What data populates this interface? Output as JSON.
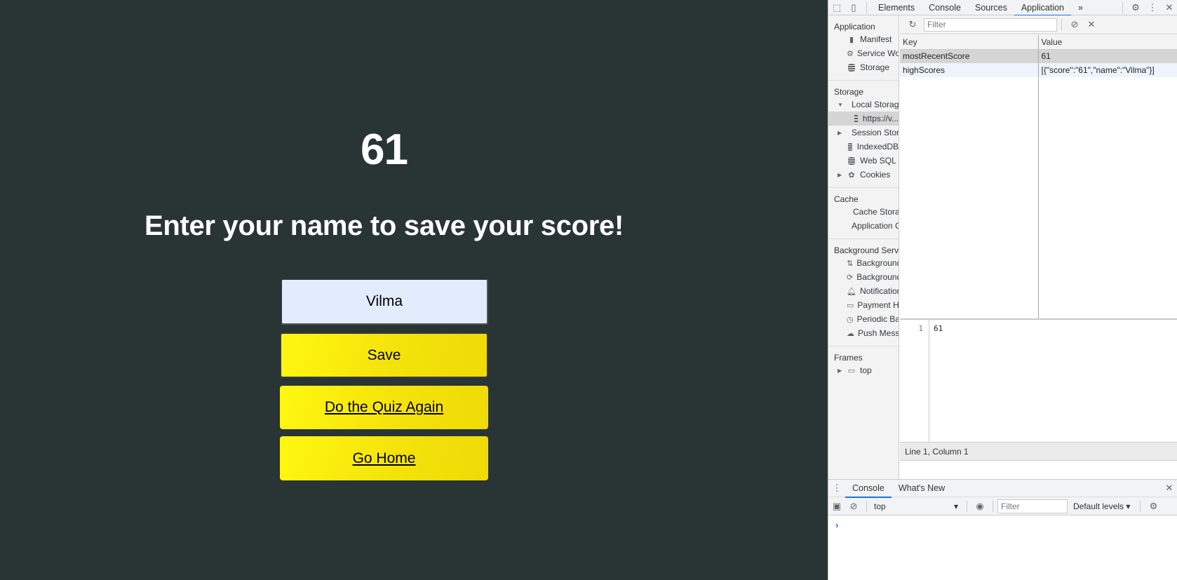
{
  "page": {
    "score": "61",
    "prompt": "Enter your name to save your score!",
    "name_input": {
      "value": "Vilma",
      "placeholder": ""
    },
    "buttons": {
      "save": "Save",
      "quiz_again": "Do the Quiz Again",
      "go_home": "Go Home"
    },
    "colors": {
      "background": "#293435",
      "button_yellow": "#f4e30b",
      "input_bg": "#e3ecfd"
    }
  },
  "devtools": {
    "tabs": [
      "Elements",
      "Console",
      "Sources",
      "Application"
    ],
    "active_tab": "Application",
    "more_tabs": "»",
    "sidebar": {
      "sections": [
        {
          "title": "Application",
          "items": [
            {
              "label": "Manifest",
              "icon": "file-icon"
            },
            {
              "label": "Service Workers",
              "icon": "gear-icon"
            },
            {
              "label": "Storage",
              "icon": "database-icon"
            }
          ]
        },
        {
          "title": "Storage",
          "items": [
            {
              "label": "Local Storage",
              "icon": "grid-icon",
              "expanded": true
            },
            {
              "label": "https://v...",
              "icon": "grid-icon",
              "selected": true
            },
            {
              "label": "Session Storage",
              "icon": "grid-icon",
              "expandable": true
            },
            {
              "label": "IndexedDB",
              "icon": "database-icon"
            },
            {
              "label": "Web SQL",
              "icon": "database-icon"
            },
            {
              "label": "Cookies",
              "icon": "cookie-icon",
              "expandable": true
            }
          ]
        },
        {
          "title": "Cache",
          "items": [
            {
              "label": "Cache Storage",
              "icon": "database-icon"
            },
            {
              "label": "Application Cache",
              "icon": "grid-icon"
            }
          ]
        },
        {
          "title": "Background Services",
          "items": [
            {
              "label": "Background Fetch",
              "icon": "arrows-updown-icon"
            },
            {
              "label": "Background Sync",
              "icon": "sync-icon"
            },
            {
              "label": "Notifications",
              "icon": "bell-icon"
            },
            {
              "label": "Payment Handler",
              "icon": "card-icon"
            },
            {
              "label": "Periodic Background Sync",
              "icon": "clock-icon"
            },
            {
              "label": "Push Messaging",
              "icon": "cloud-icon"
            }
          ]
        },
        {
          "title": "Frames",
          "items": [
            {
              "label": "top",
              "icon": "frame-icon",
              "expandable": true
            }
          ]
        }
      ]
    },
    "storage": {
      "filter_placeholder": "Filter",
      "columns": [
        "Key",
        "Value"
      ],
      "rows": [
        {
          "key": "mostRecentScore",
          "value": "61"
        },
        {
          "key": "highScores",
          "value": "[{\"score\":\"61\",\"name\":\"Vilma\"}]"
        }
      ],
      "preview": {
        "line_number": "1",
        "content": "61"
      },
      "status": "Line 1, Column 1"
    },
    "drawer": {
      "tabs": [
        "Console",
        "What's New"
      ],
      "active_tab": "Console",
      "context": "top",
      "filter_placeholder": "Filter",
      "levels": "Default levels ▾"
    }
  }
}
